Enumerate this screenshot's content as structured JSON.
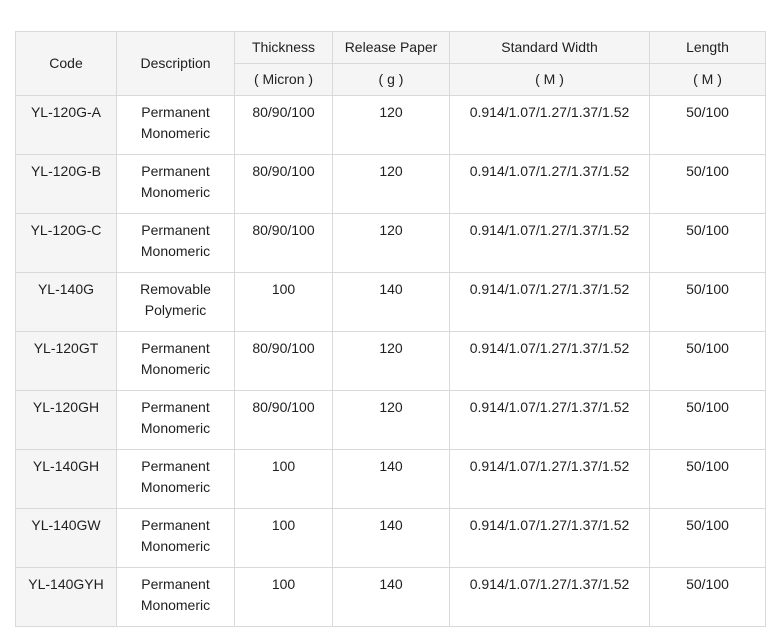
{
  "headers": {
    "code": "Code",
    "description": "Description",
    "thickness": "Thickness",
    "thickness_unit": "( Micron )",
    "release_paper": "Release Paper",
    "release_paper_unit": "( g )",
    "standard_width": "Standard Width",
    "standard_width_unit": "( M )",
    "length": "Length",
    "length_unit": "( M )"
  },
  "rows": [
    {
      "code": "YL-120G-A",
      "desc1": "Permanent",
      "desc2": "Monomeric",
      "thickness": "80/90/100",
      "release_paper": "120",
      "width": "0.914/1.07/1.27/1.37/1.52",
      "length": "50/100"
    },
    {
      "code": "YL-120G-B",
      "desc1": "Permanent",
      "desc2": "Monomeric",
      "thickness": "80/90/100",
      "release_paper": "120",
      "width": "0.914/1.07/1.27/1.37/1.52",
      "length": "50/100"
    },
    {
      "code": "YL-120G-C",
      "desc1": "Permanent",
      "desc2": "Monomeric",
      "thickness": "80/90/100",
      "release_paper": "120",
      "width": "0.914/1.07/1.27/1.37/1.52",
      "length": "50/100"
    },
    {
      "code": "YL-140G",
      "desc1": "Removable",
      "desc2": "Polymeric",
      "thickness": "100",
      "release_paper": "140",
      "width": "0.914/1.07/1.27/1.37/1.52",
      "length": "50/100"
    },
    {
      "code": "YL-120GT",
      "desc1": "Permanent",
      "desc2": "Monomeric",
      "thickness": "80/90/100",
      "release_paper": "120",
      "width": "0.914/1.07/1.27/1.37/1.52",
      "length": "50/100"
    },
    {
      "code": "YL-120GH",
      "desc1": "Permanent",
      "desc2": "Monomeric",
      "thickness": "80/90/100",
      "release_paper": "120",
      "width": "0.914/1.07/1.27/1.37/1.52",
      "length": "50/100"
    },
    {
      "code": "YL-140GH",
      "desc1": "Permanent",
      "desc2": "Monomeric",
      "thickness": "100",
      "release_paper": "140",
      "width": "0.914/1.07/1.27/1.37/1.52",
      "length": "50/100"
    },
    {
      "code": "YL-140GW",
      "desc1": "Permanent",
      "desc2": "Monomeric",
      "thickness": "100",
      "release_paper": "140",
      "width": "0.914/1.07/1.27/1.37/1.52",
      "length": "50/100"
    },
    {
      "code": "YL-140GYH",
      "desc1": "Permanent",
      "desc2": "Monomeric",
      "thickness": "100",
      "release_paper": "140",
      "width": "0.914/1.07/1.27/1.37/1.52",
      "length": "50/100"
    }
  ]
}
